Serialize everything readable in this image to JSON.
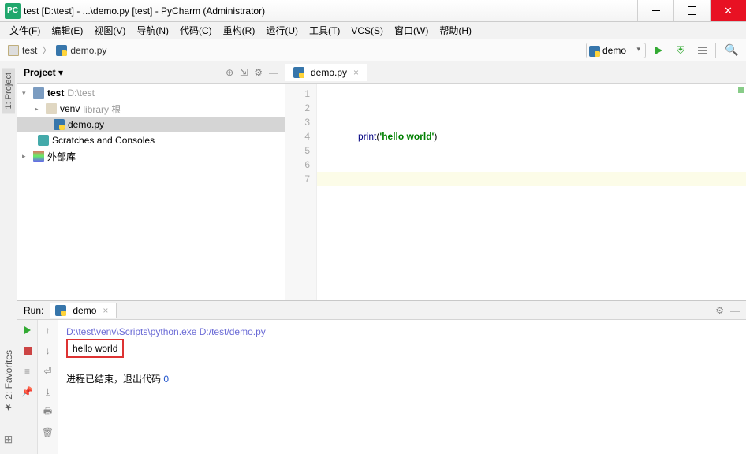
{
  "window": {
    "title": "test [D:\\test] - ...\\demo.py [test] - PyCharm (Administrator)",
    "app_icon_text": "PC"
  },
  "menu": {
    "file": "文件(F)",
    "edit": "编辑(E)",
    "view": "视图(V)",
    "navigate": "导航(N)",
    "code": "代码(C)",
    "refactor": "重构(R)",
    "run": "运行(U)",
    "tools": "工具(T)",
    "vcs": "VCS(S)",
    "window": "窗口(W)",
    "help": "帮助(H)"
  },
  "breadcrumb": {
    "project": "test",
    "file": "demo.py"
  },
  "toolbar": {
    "run_config": "demo"
  },
  "left_tabs": {
    "project": "1: Project",
    "favorites": "2: Favorites",
    "structure": "⊞"
  },
  "project_panel": {
    "title": "Project",
    "root": {
      "name": "test",
      "path": "D:\\test"
    },
    "venv": {
      "name": "venv",
      "suffix": "library 根"
    },
    "file": "demo.py",
    "scratches": "Scratches and Consoles",
    "external": "外部库"
  },
  "editor": {
    "tab": "demo.py",
    "lines": [
      "1",
      "2",
      "3",
      "4",
      "5",
      "6",
      "7"
    ],
    "code_print": "print",
    "code_open": "(",
    "code_str": "'hello world'",
    "code_close": ")"
  },
  "run": {
    "header": "Run:",
    "tab": "demo",
    "cmd": "D:\\test\\venv\\Scripts\\python.exe D:/test/demo.py",
    "output": "hello world",
    "exit_prefix": "进程已结束，退出代码 ",
    "exit_code": "0"
  }
}
